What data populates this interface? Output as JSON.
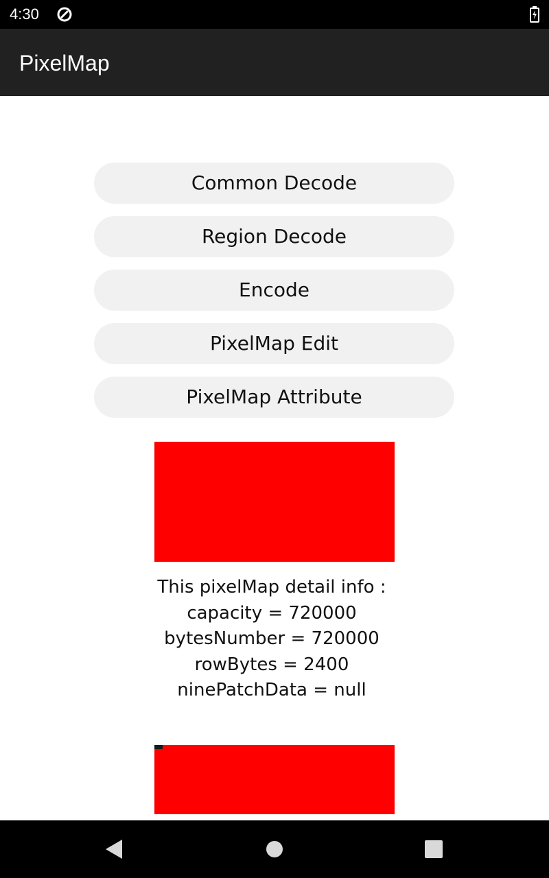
{
  "status_bar": {
    "time": "4:30",
    "icons": [
      "sync-icon",
      "battery-charging-icon"
    ]
  },
  "app_bar": {
    "title": "PixelMap"
  },
  "buttons": [
    {
      "label": "Common Decode"
    },
    {
      "label": "Region Decode"
    },
    {
      "label": "Encode"
    },
    {
      "label": "PixelMap Edit"
    },
    {
      "label": "PixelMap Attribute"
    }
  ],
  "images": {
    "primary_color": "#ff0000",
    "secondary_color": "#ff0000"
  },
  "info": {
    "lines": [
      "This pixelMap detail info :",
      "capacity = 720000",
      "bytesNumber = 720000",
      "rowBytes = 2400",
      "ninePatchData = null"
    ]
  },
  "nav_bar": {
    "icons": [
      "back-icon",
      "home-icon",
      "recents-icon"
    ]
  },
  "colors": {
    "app_bar": "#212121",
    "status_bar": "#000000",
    "button_bg": "#f1f1f1"
  }
}
